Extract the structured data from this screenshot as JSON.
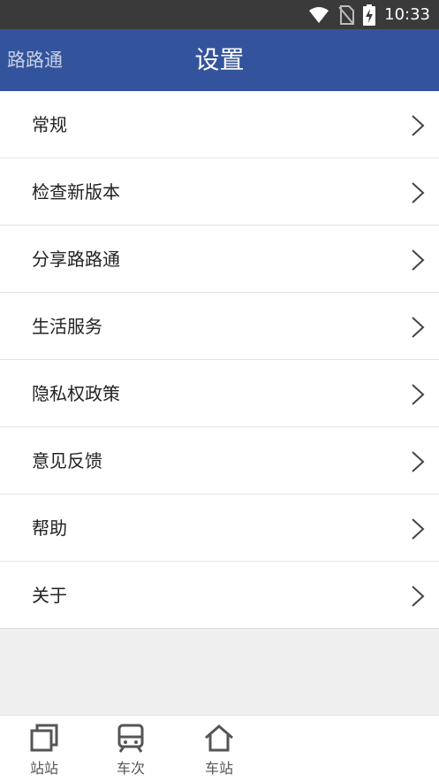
{
  "status_bar": {
    "time": "10:33"
  },
  "app_bar": {
    "app_name": "路路通",
    "title": "设置"
  },
  "settings": {
    "items": [
      {
        "label": "常规"
      },
      {
        "label": "检查新版本"
      },
      {
        "label": "分享路路通"
      },
      {
        "label": "生活服务"
      },
      {
        "label": "隐私权政策"
      },
      {
        "label": "意见反馈"
      },
      {
        "label": "帮助"
      },
      {
        "label": "关于"
      }
    ]
  },
  "bottom_nav": {
    "items": [
      {
        "label": "站站",
        "icon": "stations-icon"
      },
      {
        "label": "车次",
        "icon": "train-icon"
      },
      {
        "label": "车站",
        "icon": "home-icon"
      }
    ]
  },
  "colors": {
    "header": "#33539c",
    "status_bar": "#3a3a3a",
    "icon_gray": "#555555"
  }
}
